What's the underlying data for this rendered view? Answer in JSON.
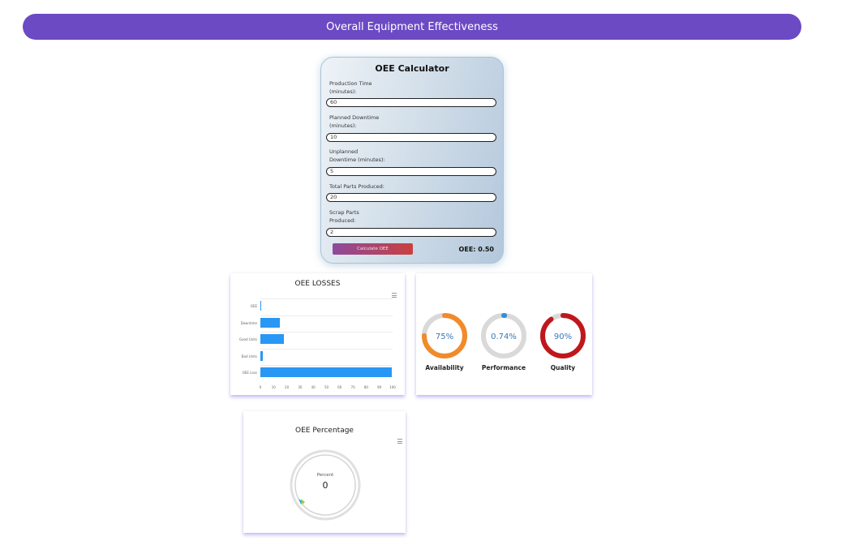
{
  "header": {
    "title": "Overall Equipment Effectiveness"
  },
  "calculator": {
    "title": "OEE Calculator",
    "fields": [
      {
        "label_line1": "Production Time",
        "label_line2": "(minutes):",
        "value": "60"
      },
      {
        "label_line1": "Planned Downtime",
        "label_line2": "(minutes):",
        "value": "10"
      },
      {
        "label_line1": "Unplanned",
        "label_line2": "Downtime (minutes):",
        "value": "5"
      },
      {
        "label_line1": "Total Parts Produced:",
        "label_line2": "",
        "value": "20"
      },
      {
        "label_line1": "Scrap Parts",
        "label_line2": "Produced:",
        "value": "2"
      }
    ],
    "button_label": "Calculate OEE",
    "result": "OEE: 0.50"
  },
  "losses_chart": {
    "title": "OEE LOSSES",
    "chart_data": {
      "type": "bar",
      "orientation": "horizontal",
      "title": "OEE LOSSES",
      "categories": [
        "OEE",
        "Downtime",
        "Good Units",
        "Bad Units",
        "OEE Loss"
      ],
      "values": [
        0.5,
        15,
        18,
        2,
        99.5
      ],
      "xlim": [
        0,
        100
      ],
      "ticks": [
        "0",
        "10",
        "20",
        "30",
        "40",
        "50",
        "60",
        "70",
        "80",
        "90",
        "100"
      ],
      "color": "#2997f4",
      "grid": true
    }
  },
  "metrics": {
    "chart_data": {
      "type": "pie",
      "charts": [
        {
          "label": "Availability",
          "value_text": "75%",
          "value": 75,
          "color": "#f18b2a"
        },
        {
          "label": "Performance",
          "value_text": "0.74%",
          "value": 0.74,
          "color": "#2f8fe0"
        },
        {
          "label": "Quality",
          "value_text": "90%",
          "value": 90,
          "color": "#c0171c"
        }
      ],
      "track_color": "#d9d9d9"
    }
  },
  "percentage_gauge": {
    "title": "OEE Percentage",
    "label": "Percent",
    "value": "0",
    "chart_data": {
      "type": "pie",
      "value": 0,
      "max": 100
    }
  }
}
